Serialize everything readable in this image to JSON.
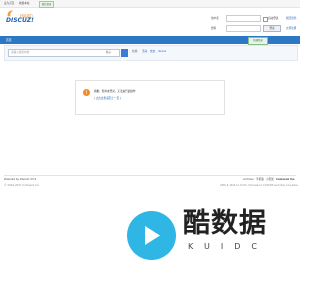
{
  "topbar": {
    "set_home": "设为首页",
    "bookmark": "收藏本站",
    "wechat_login": "微信登录"
  },
  "logo": {
    "text": "DISCUZ!",
    "cn": "社区动力"
  },
  "login": {
    "username_label": "用户名",
    "password_label": "密码",
    "auto_login": "自动登录",
    "forgot": "找回密码",
    "register": "立即注册",
    "login_button": "登录"
  },
  "nav": {
    "home": "首页",
    "qr": "快捷登录"
  },
  "search": {
    "placeholder": "请输入搜索内容",
    "scope": "帖子",
    "hot_label": "热搜:",
    "hot": [
      "活动",
      "交友",
      "discuz"
    ]
  },
  "message": {
    "icon": "alert-icon",
    "text": "抱歉，您尚未登录，无法进行此操作",
    "back": "[ 点击这里返回上一页 ]"
  },
  "footer": {
    "powered": "Powered by Discuz! X3.4",
    "copyright": "© 2001-2017 Comsenz Inc.",
    "archiver": "Archiver",
    "mobile": "手机版",
    "dark": "小黑屋",
    "brand": "Comsenz Inc.",
    "time": "GMT+8, 2024-1-1 10:00 , Processed in 0.031205 second(s), 14 queries ."
  },
  "watermark": {
    "title": "酷数据",
    "sub": "KUIDC"
  },
  "colors": {
    "nav_blue": "#2b78c5",
    "accent_orange": "#ef8a2b",
    "watermark_blue": "#2fb6e4"
  }
}
